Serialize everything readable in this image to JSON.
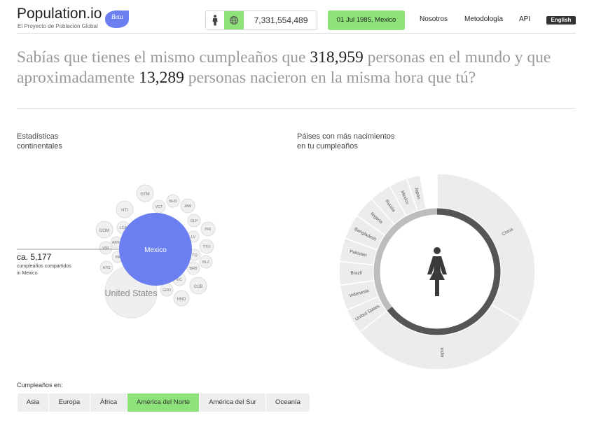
{
  "header": {
    "logo": "Population.io",
    "tagline": "El Proyecto de Población Global",
    "beta": "Beta",
    "population": "7,331,554,489",
    "date_country": "01 Jul 1985, Mexico",
    "nav": [
      "Nosotros",
      "Metodología",
      "API"
    ],
    "language": "English"
  },
  "headline": {
    "part1": "Sabías que tienes el mismo cumpleaños que ",
    "num1": "318,959",
    "part2": " personas en el mundo y que aproximadamente ",
    "num2": "13,289",
    "part3": " personas nacieron en la misma hora que tú?"
  },
  "continental": {
    "title_line1": "Estadísticas",
    "title_line2": "continentales",
    "count": "ca. 5,177",
    "count_label_line1": "cumpleaños compartidos",
    "count_label_line2": "in Mexico",
    "bubbles": [
      "Mexico",
      "United States",
      "GTM",
      "BHS",
      "VCT",
      "JAM",
      "HTI",
      "GLP",
      "DOM",
      "LCA",
      "PRI",
      "ABW",
      "LV",
      "TTO",
      "VIR",
      "PA",
      "TQ",
      "BLZ",
      "ATG",
      "BRB",
      "CUB",
      "GRD",
      "EC",
      "HND"
    ]
  },
  "countries": {
    "title_line1": "Páises con más nacimientos",
    "title_line2": "en tu cumpleaños",
    "segments": [
      "China",
      "India",
      "United States",
      "Indonesia",
      "Brazil",
      "Pakistan",
      "Bangladesh",
      "Nigeria",
      "Russia",
      "Mexico",
      "Japan"
    ]
  },
  "birthdays_in": {
    "label": "Cumpleaños en:",
    "tabs": [
      "Asia",
      "Europa",
      "África",
      "América del Norte",
      "América del Sur",
      "Oceanía"
    ],
    "active_tab": "América del Norte"
  },
  "colors": {
    "accent_green": "#8ee27a",
    "bubble_blue": "#6b7ff0",
    "ring_gray": "#ececec",
    "dark_arc": "#555555"
  },
  "icons": [
    "person-icon",
    "globe-icon",
    "woman-icon",
    "beta-badge"
  ]
}
